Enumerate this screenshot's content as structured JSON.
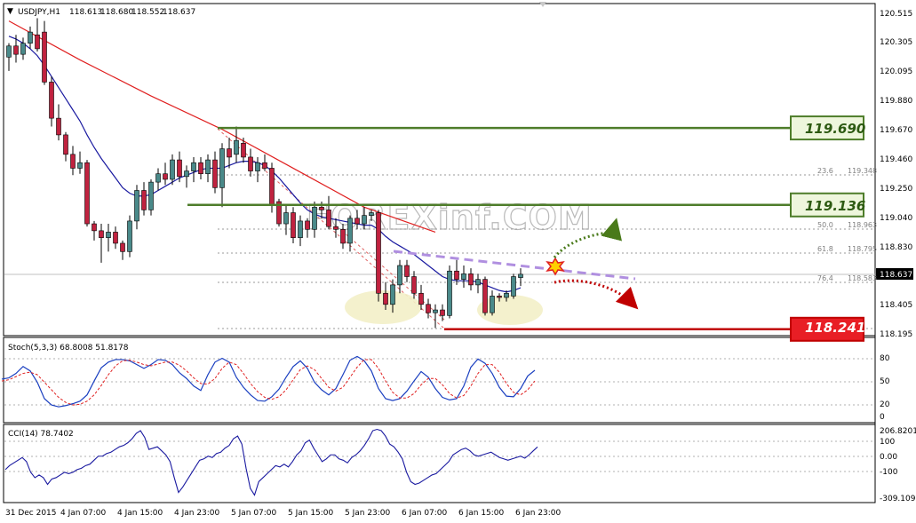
{
  "header": {
    "symbol_label": "USDJPY,H1",
    "values": [
      "118.613",
      "118.680",
      "118.552",
      "118.637"
    ]
  },
  "watermark": "FOREXinf.COM",
  "price_axis": {
    "ticks": [
      "120.515",
      "120.305",
      "120.095",
      "119.880",
      "119.670",
      "119.460",
      "119.250",
      "119.040",
      "118.830",
      "118.615",
      "118.405",
      "118.195"
    ],
    "current_price_label": "118.637"
  },
  "levels": [
    {
      "name": "resistance-upper",
      "label": "119.690",
      "value": 119.69,
      "color": "#4e7d2a",
      "label_color": "#2d5a12",
      "box_fill": "#eef6dc"
    },
    {
      "name": "resistance-lower",
      "label": "119.136",
      "value": 119.136,
      "color": "#4e7d2a",
      "label_color": "#2d5a12",
      "box_fill": "#eef6dc"
    },
    {
      "name": "support",
      "label": "118.241",
      "value": 118.241,
      "color": "#c00000",
      "label_color": "#ffffff",
      "box_fill": "#e81e25"
    }
  ],
  "fibonacci": [
    {
      "ratio": "23.6",
      "price": "119.348"
    },
    {
      "ratio": "50.0",
      "price": "118.963"
    },
    {
      "ratio": "61.8",
      "price": "118.795"
    },
    {
      "ratio": "76.4",
      "price": "118.583"
    }
  ],
  "stochastic": {
    "label": "Stoch(5,3,3) 68.8008 51.8178",
    "ticks": [
      "80",
      "50",
      "20",
      "0"
    ]
  },
  "cci": {
    "label": "CCI(14) 78.7402",
    "ticks": [
      "206.8201",
      "100",
      "0.00",
      "-100",
      "-309.1092"
    ]
  },
  "time_axis": {
    "labels": [
      "31 Dec 2015",
      "4 Jan 07:00",
      "4 Jan 15:00",
      "4 Jan 23:00",
      "5 Jan 07:00",
      "5 Jan 15:00",
      "5 Jan 23:00",
      "6 Jan 07:00",
      "6 Jan 15:00",
      "6 Jan 23:00"
    ]
  },
  "colors": {
    "bull": "#4a8a8a",
    "bear": "#c0223f",
    "ma_slow": "#e02020",
    "ma_fast": "#1a1aa0",
    "trendline": "#b08fe0",
    "up_arrow": "#4a7a1a",
    "down_arrow": "#c00000"
  },
  "chart_data": {
    "type": "candlestick",
    "symbol": "USDJPY",
    "timeframe": "H1",
    "ylim": [
      118.195,
      120.515
    ],
    "candles": [
      {
        "o": 120.2,
        "h": 120.3,
        "l": 120.1,
        "c": 120.28
      },
      {
        "o": 120.28,
        "h": 120.36,
        "l": 120.16,
        "c": 120.22
      },
      {
        "o": 120.22,
        "h": 120.34,
        "l": 120.18,
        "c": 120.3
      },
      {
        "o": 120.3,
        "h": 120.42,
        "l": 120.26,
        "c": 120.38
      },
      {
        "o": 120.36,
        "h": 120.48,
        "l": 120.24,
        "c": 120.26
      },
      {
        "o": 120.38,
        "h": 120.46,
        "l": 120.0,
        "c": 120.02
      },
      {
        "o": 120.02,
        "h": 120.06,
        "l": 119.7,
        "c": 119.76
      },
      {
        "o": 119.76,
        "h": 119.86,
        "l": 119.6,
        "c": 119.64
      },
      {
        "o": 119.64,
        "h": 119.66,
        "l": 119.45,
        "c": 119.5
      },
      {
        "o": 119.5,
        "h": 119.56,
        "l": 119.35,
        "c": 119.4
      },
      {
        "o": 119.4,
        "h": 119.52,
        "l": 119.36,
        "c": 119.44
      },
      {
        "o": 119.44,
        "h": 119.46,
        "l": 118.98,
        "c": 119.0
      },
      {
        "o": 119.0,
        "h": 119.02,
        "l": 118.88,
        "c": 118.95
      },
      {
        "o": 118.95,
        "h": 119.0,
        "l": 118.72,
        "c": 118.9
      },
      {
        "o": 118.9,
        "h": 119.0,
        "l": 118.8,
        "c": 118.94
      },
      {
        "o": 118.94,
        "h": 118.98,
        "l": 118.82,
        "c": 118.86
      },
      {
        "o": 118.86,
        "h": 118.88,
        "l": 118.74,
        "c": 118.8
      },
      {
        "o": 118.8,
        "h": 119.06,
        "l": 118.76,
        "c": 119.02
      },
      {
        "o": 119.02,
        "h": 119.28,
        "l": 118.96,
        "c": 119.24
      },
      {
        "o": 119.24,
        "h": 119.3,
        "l": 119.06,
        "c": 119.1
      },
      {
        "o": 119.1,
        "h": 119.32,
        "l": 119.06,
        "c": 119.3
      },
      {
        "o": 119.3,
        "h": 119.4,
        "l": 119.24,
        "c": 119.36
      },
      {
        "o": 119.36,
        "h": 119.44,
        "l": 119.28,
        "c": 119.32
      },
      {
        "o": 119.32,
        "h": 119.5,
        "l": 119.28,
        "c": 119.46
      },
      {
        "o": 119.46,
        "h": 119.52,
        "l": 119.3,
        "c": 119.34
      },
      {
        "o": 119.34,
        "h": 119.42,
        "l": 119.26,
        "c": 119.38
      },
      {
        "o": 119.38,
        "h": 119.48,
        "l": 119.3,
        "c": 119.44
      },
      {
        "o": 119.44,
        "h": 119.48,
        "l": 119.32,
        "c": 119.36
      },
      {
        "o": 119.36,
        "h": 119.5,
        "l": 119.3,
        "c": 119.46
      },
      {
        "o": 119.46,
        "h": 119.52,
        "l": 119.22,
        "c": 119.26
      },
      {
        "o": 119.26,
        "h": 119.58,
        "l": 119.12,
        "c": 119.54
      },
      {
        "o": 119.54,
        "h": 119.62,
        "l": 119.4,
        "c": 119.48
      },
      {
        "o": 119.5,
        "h": 119.7,
        "l": 119.44,
        "c": 119.6
      },
      {
        "o": 119.58,
        "h": 119.62,
        "l": 119.44,
        "c": 119.48
      },
      {
        "o": 119.48,
        "h": 119.54,
        "l": 119.34,
        "c": 119.38
      },
      {
        "o": 119.38,
        "h": 119.48,
        "l": 119.3,
        "c": 119.44
      },
      {
        "o": 119.44,
        "h": 119.5,
        "l": 119.38,
        "c": 119.4
      },
      {
        "o": 119.4,
        "h": 119.44,
        "l": 119.08,
        "c": 119.14
      },
      {
        "o": 119.16,
        "h": 119.18,
        "l": 118.98,
        "c": 119.0
      },
      {
        "o": 119.0,
        "h": 119.14,
        "l": 118.92,
        "c": 119.08
      },
      {
        "o": 119.08,
        "h": 119.12,
        "l": 118.86,
        "c": 118.9
      },
      {
        "o": 118.9,
        "h": 119.06,
        "l": 118.84,
        "c": 119.02
      },
      {
        "o": 119.02,
        "h": 119.04,
        "l": 118.9,
        "c": 118.96
      },
      {
        "o": 118.96,
        "h": 119.16,
        "l": 118.9,
        "c": 119.12
      },
      {
        "o": 119.12,
        "h": 119.16,
        "l": 119.04,
        "c": 119.1
      },
      {
        "o": 119.1,
        "h": 119.2,
        "l": 118.96,
        "c": 118.98
      },
      {
        "o": 118.98,
        "h": 119.04,
        "l": 118.9,
        "c": 118.96
      },
      {
        "o": 118.96,
        "h": 119.0,
        "l": 118.82,
        "c": 118.86
      },
      {
        "o": 118.86,
        "h": 119.06,
        "l": 118.8,
        "c": 119.04
      },
      {
        "o": 119.04,
        "h": 119.1,
        "l": 118.96,
        "c": 119.0
      },
      {
        "o": 119.0,
        "h": 119.12,
        "l": 118.96,
        "c": 119.06
      },
      {
        "o": 119.06,
        "h": 119.1,
        "l": 119.02,
        "c": 119.08
      },
      {
        "o": 119.08,
        "h": 119.1,
        "l": 118.44,
        "c": 118.5
      },
      {
        "o": 118.5,
        "h": 118.58,
        "l": 118.38,
        "c": 118.42
      },
      {
        "o": 118.42,
        "h": 118.6,
        "l": 118.36,
        "c": 118.56
      },
      {
        "o": 118.56,
        "h": 118.74,
        "l": 118.5,
        "c": 118.7
      },
      {
        "o": 118.7,
        "h": 118.74,
        "l": 118.58,
        "c": 118.62
      },
      {
        "o": 118.62,
        "h": 118.66,
        "l": 118.46,
        "c": 118.5
      },
      {
        "o": 118.5,
        "h": 118.56,
        "l": 118.38,
        "c": 118.42
      },
      {
        "o": 118.42,
        "h": 118.46,
        "l": 118.32,
        "c": 118.36
      },
      {
        "o": 118.36,
        "h": 118.42,
        "l": 118.25,
        "c": 118.38
      },
      {
        "o": 118.38,
        "h": 118.42,
        "l": 118.3,
        "c": 118.34
      },
      {
        "o": 118.34,
        "h": 118.7,
        "l": 118.32,
        "c": 118.66
      },
      {
        "o": 118.66,
        "h": 118.74,
        "l": 118.56,
        "c": 118.6
      },
      {
        "o": 118.6,
        "h": 118.7,
        "l": 118.54,
        "c": 118.64
      },
      {
        "o": 118.64,
        "h": 118.68,
        "l": 118.52,
        "c": 118.56
      },
      {
        "o": 118.56,
        "h": 118.64,
        "l": 118.5,
        "c": 118.6
      },
      {
        "o": 118.6,
        "h": 118.62,
        "l": 118.34,
        "c": 118.36
      },
      {
        "o": 118.36,
        "h": 118.52,
        "l": 118.34,
        "c": 118.48
      },
      {
        "o": 118.48,
        "h": 118.5,
        "l": 118.44,
        "c": 118.47
      },
      {
        "o": 118.47,
        "h": 118.52,
        "l": 118.44,
        "c": 118.5
      },
      {
        "o": 118.48,
        "h": 118.64,
        "l": 118.46,
        "c": 118.62
      },
      {
        "o": 118.613,
        "h": 118.68,
        "l": 118.552,
        "c": 118.637
      }
    ],
    "ma_fast": [
      120.35,
      120.33,
      120.3,
      120.26,
      120.21,
      120.14,
      120.06,
      119.98,
      119.9,
      119.82,
      119.74,
      119.64,
      119.55,
      119.47,
      119.4,
      119.33,
      119.26,
      119.22,
      119.2,
      119.2,
      119.21,
      119.24,
      119.27,
      119.3,
      119.33,
      119.35,
      119.37,
      119.39,
      119.4,
      119.4,
      119.4,
      119.42,
      119.44,
      119.45,
      119.45,
      119.44,
      119.42,
      119.38,
      119.33,
      119.27,
      119.21,
      119.15,
      119.1,
      119.07,
      119.05,
      119.04,
      119.03,
      119.02,
      119.01,
      119.0,
      118.99,
      118.99,
      118.96,
      118.91,
      118.87,
      118.84,
      118.81,
      118.78,
      118.74,
      118.7,
      118.66,
      118.62,
      118.6,
      118.59,
      118.59,
      118.59,
      118.58,
      118.56,
      118.54,
      118.52,
      118.51,
      118.52,
      118.54
    ],
    "ma_slow_points": [
      [
        0,
        120.46
      ],
      [
        10,
        120.18
      ],
      [
        20,
        119.92
      ],
      [
        30,
        119.68
      ],
      [
        40,
        119.4
      ],
      [
        50,
        119.12
      ],
      [
        60,
        118.94
      ]
    ],
    "fibonacci": [
      {
        "ratio": 23.6,
        "price": 119.348
      },
      {
        "ratio": 50.0,
        "price": 118.963
      },
      {
        "ratio": 61.8,
        "price": 118.795
      },
      {
        "ratio": 76.4,
        "price": 118.583
      }
    ],
    "horizontal_levels": [
      119.69,
      119.136,
      118.241
    ],
    "stochastic": {
      "params": "5,3,3",
      "main": 68.8008,
      "signal": 51.8178,
      "ylim": [
        0,
        100
      ],
      "main_values": [
        55,
        57,
        64,
        75,
        68,
        50,
        24,
        14,
        11,
        13,
        16,
        20,
        30,
        52,
        73,
        82,
        86,
        86,
        84,
        78,
        72,
        78,
        86,
        85,
        78,
        65,
        56,
        44,
        37,
        62,
        82,
        88,
        82,
        58,
        42,
        30,
        21,
        20,
        27,
        39,
        58,
        75,
        84,
        72,
        50,
        38,
        30,
        40,
        62,
        85,
        91,
        84,
        68,
        40,
        24,
        21,
        24,
        36,
        52,
        67,
        58,
        40,
        26,
        22,
        24,
        44,
        74,
        87,
        80,
        64,
        42,
        28,
        27,
        40,
        60,
        69
      ],
      "signal_values": [
        52,
        54,
        59,
        64,
        66,
        62,
        50,
        38,
        26,
        18,
        14,
        15,
        20,
        30,
        45,
        62,
        76,
        84,
        85,
        82,
        78,
        76,
        79,
        82,
        82,
        77,
        68,
        57,
        48,
        47,
        56,
        72,
        82,
        78,
        64,
        48,
        35,
        26,
        23,
        27,
        38,
        54,
        70,
        76,
        70,
        56,
        42,
        36,
        42,
        58,
        74,
        86,
        86,
        72,
        52,
        34,
        25,
        25,
        32,
        46,
        56,
        56,
        46,
        32,
        25,
        29,
        44,
        64,
        78,
        78,
        66,
        48,
        34,
        30,
        38,
        52
      ]
    },
    "cci": {
      "period": 14,
      "value": 78.7402,
      "ylim": [
        -309.1092,
        206.8201
      ],
      "values": [
        -90,
        -60,
        -40,
        -20,
        0,
        -30,
        -110,
        -150,
        -130,
        -150,
        -200,
        -160,
        -150,
        -130,
        -110,
        -120,
        -110,
        -90,
        -80,
        -60,
        -50,
        -20,
        10,
        10,
        30,
        40,
        60,
        80,
        90,
        110,
        140,
        180,
        200,
        150,
        60,
        70,
        80,
        50,
        20,
        -30,
        -150,
        -260,
        -220,
        -170,
        -120,
        -70,
        -20,
        -10,
        10,
        0,
        30,
        40,
        70,
        90,
        140,
        160,
        100,
        -80,
        -230,
        -280,
        -180,
        -150,
        -120,
        -90,
        -60,
        -70,
        -50,
        -70,
        -30,
        20,
        50,
        110,
        130,
        70,
        20,
        -30,
        -10,
        20,
        20,
        -10,
        -20,
        -40,
        0,
        20,
        50,
        90,
        140,
        200,
        210,
        200,
        160,
        100,
        80,
        40,
        -10,
        -110,
        -180,
        -200,
        -190,
        -170,
        -150,
        -130,
        -120,
        -90,
        -60,
        -30,
        20,
        40,
        60,
        70,
        50,
        20,
        10,
        20,
        30,
        40,
        20,
        0,
        -10,
        -20,
        -10,
        0,
        10,
        -5,
        20,
        50,
        79
      ]
    }
  }
}
